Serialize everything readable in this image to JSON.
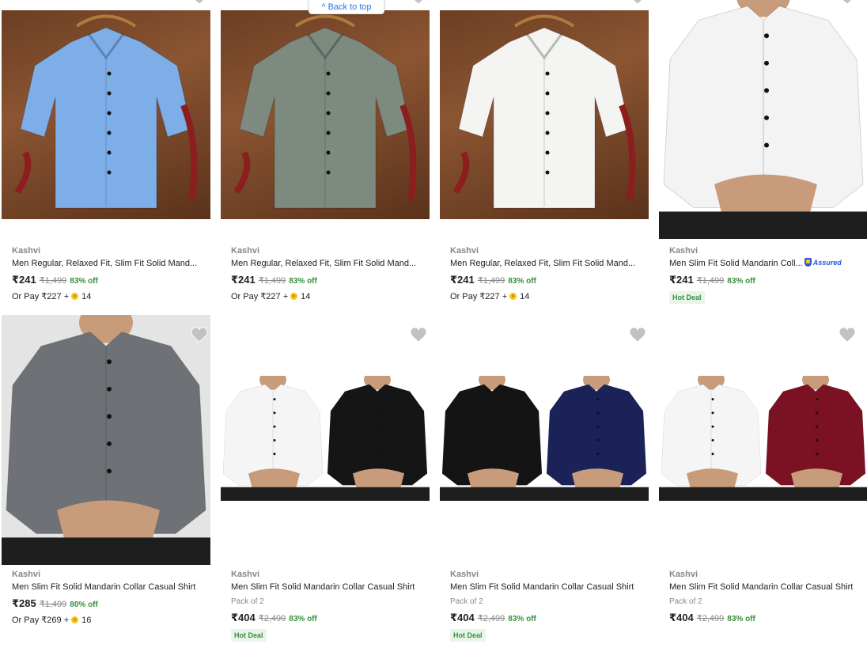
{
  "back_to_top": "Back to top",
  "products": [
    {
      "brand": "Kashvi",
      "title": "Men Regular, Relaxed Fit, Slim Fit Solid Mand...",
      "price": "₹241",
      "mrp": "₹1,499",
      "off": "83% off",
      "pay_prefix": "Or Pay ₹227 +",
      "coins": "14",
      "shirt_color": "#7eaee8",
      "bg": "wood"
    },
    {
      "brand": "Kashvi",
      "title": "Men Regular, Relaxed Fit, Slim Fit Solid Mand...",
      "price": "₹241",
      "mrp": "₹1,499",
      "off": "83% off",
      "pay_prefix": "Or Pay ₹227 +",
      "coins": "14",
      "shirt_color": "#7d8a80",
      "bg": "wood"
    },
    {
      "brand": "Kashvi",
      "title": "Men Regular, Relaxed Fit, Slim Fit Solid Mand...",
      "price": "₹241",
      "mrp": "₹1,499",
      "off": "83% off",
      "pay_prefix": "Or Pay ₹227 +",
      "coins": "14",
      "shirt_color": "#f4f4f2",
      "bg": "wood"
    },
    {
      "brand": "Kashvi",
      "title": "Men Slim Fit Solid Mandarin Coll...",
      "assured": "Assured",
      "price": "₹241",
      "mrp": "₹1,499",
      "off": "83% off",
      "hot": "Hot Deal",
      "shirt_color": "#f3f3f3",
      "bg": "studio"
    },
    {
      "brand": "Kashvi",
      "title": "Men Slim Fit Solid Mandarin Collar Casual Shirt",
      "price": "₹285",
      "mrp": "₹1,499",
      "off": "80% off",
      "pay_prefix": "Or Pay ₹269 +",
      "coins": "16",
      "shirt_color": "#6e7276",
      "bg": "studio"
    },
    {
      "brand": "Kashvi",
      "title": "Men Slim Fit Solid Mandarin Collar Casual Shirt",
      "pack": "Pack of 2",
      "price": "₹404",
      "mrp": "₹2,499",
      "off": "83% off",
      "hot": "Hot Deal",
      "shirt_color": "#f5f5f5",
      "shirt_color2": "#151515",
      "bg": "studio"
    },
    {
      "brand": "Kashvi",
      "title": "Men Slim Fit Solid Mandarin Collar Casual Shirt",
      "pack": "Pack of 2",
      "price": "₹404",
      "mrp": "₹2,499",
      "off": "83% off",
      "hot": "Hot Deal",
      "shirt_color": "#141414",
      "shirt_color2": "#1a2258",
      "bg": "studio"
    },
    {
      "brand": "Kashvi",
      "title": "Men Slim Fit Solid Mandarin Collar Casual Shirt",
      "pack": "Pack of 2",
      "price": "₹404",
      "mrp": "₹2,499",
      "off": "83% off",
      "shirt_color": "#f5f5f5",
      "shirt_color2": "#7a1224",
      "bg": "studio"
    }
  ]
}
